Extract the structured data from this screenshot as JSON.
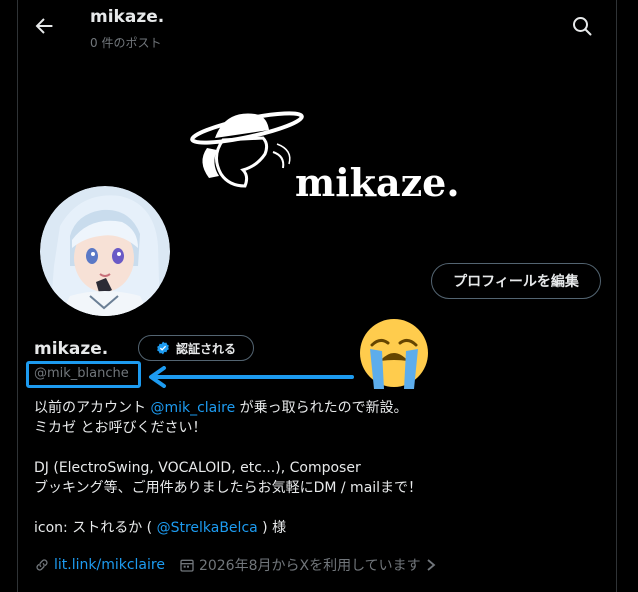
{
  "header": {
    "title": "mikaze.",
    "post_count": "0 件のポスト"
  },
  "banner": {
    "brand": "mikaze."
  },
  "profile": {
    "edit_button": "プロフィールを編集",
    "name": "mikaze.",
    "verify_button": "認証される",
    "handle": "@mik_blanche"
  },
  "bio": {
    "line1_pre": "以前のアカウント ",
    "line1_mention": "@mik_claire",
    "line1_post": " が乗っ取られたので新設。",
    "line2": "ミカゼ とお呼びください！",
    "line3": "DJ (ElectroSwing, VOCALOID, etc...), Composer",
    "line4": "ブッキング等、ご用件ありましたらお気軽にDM / mailまで！",
    "line5_pre": "icon: ストれるか ( ",
    "line5_mention": "@StrelkaBelca",
    "line5_post": " ) 様"
  },
  "meta": {
    "link": "lit.link/mikclaire",
    "joined": "2026年8月からXを利用しています"
  },
  "colors": {
    "accent": "#1d9bf0",
    "muted": "#71767b",
    "text": "#e7e9ea",
    "emoji": "#ffcc4d"
  }
}
